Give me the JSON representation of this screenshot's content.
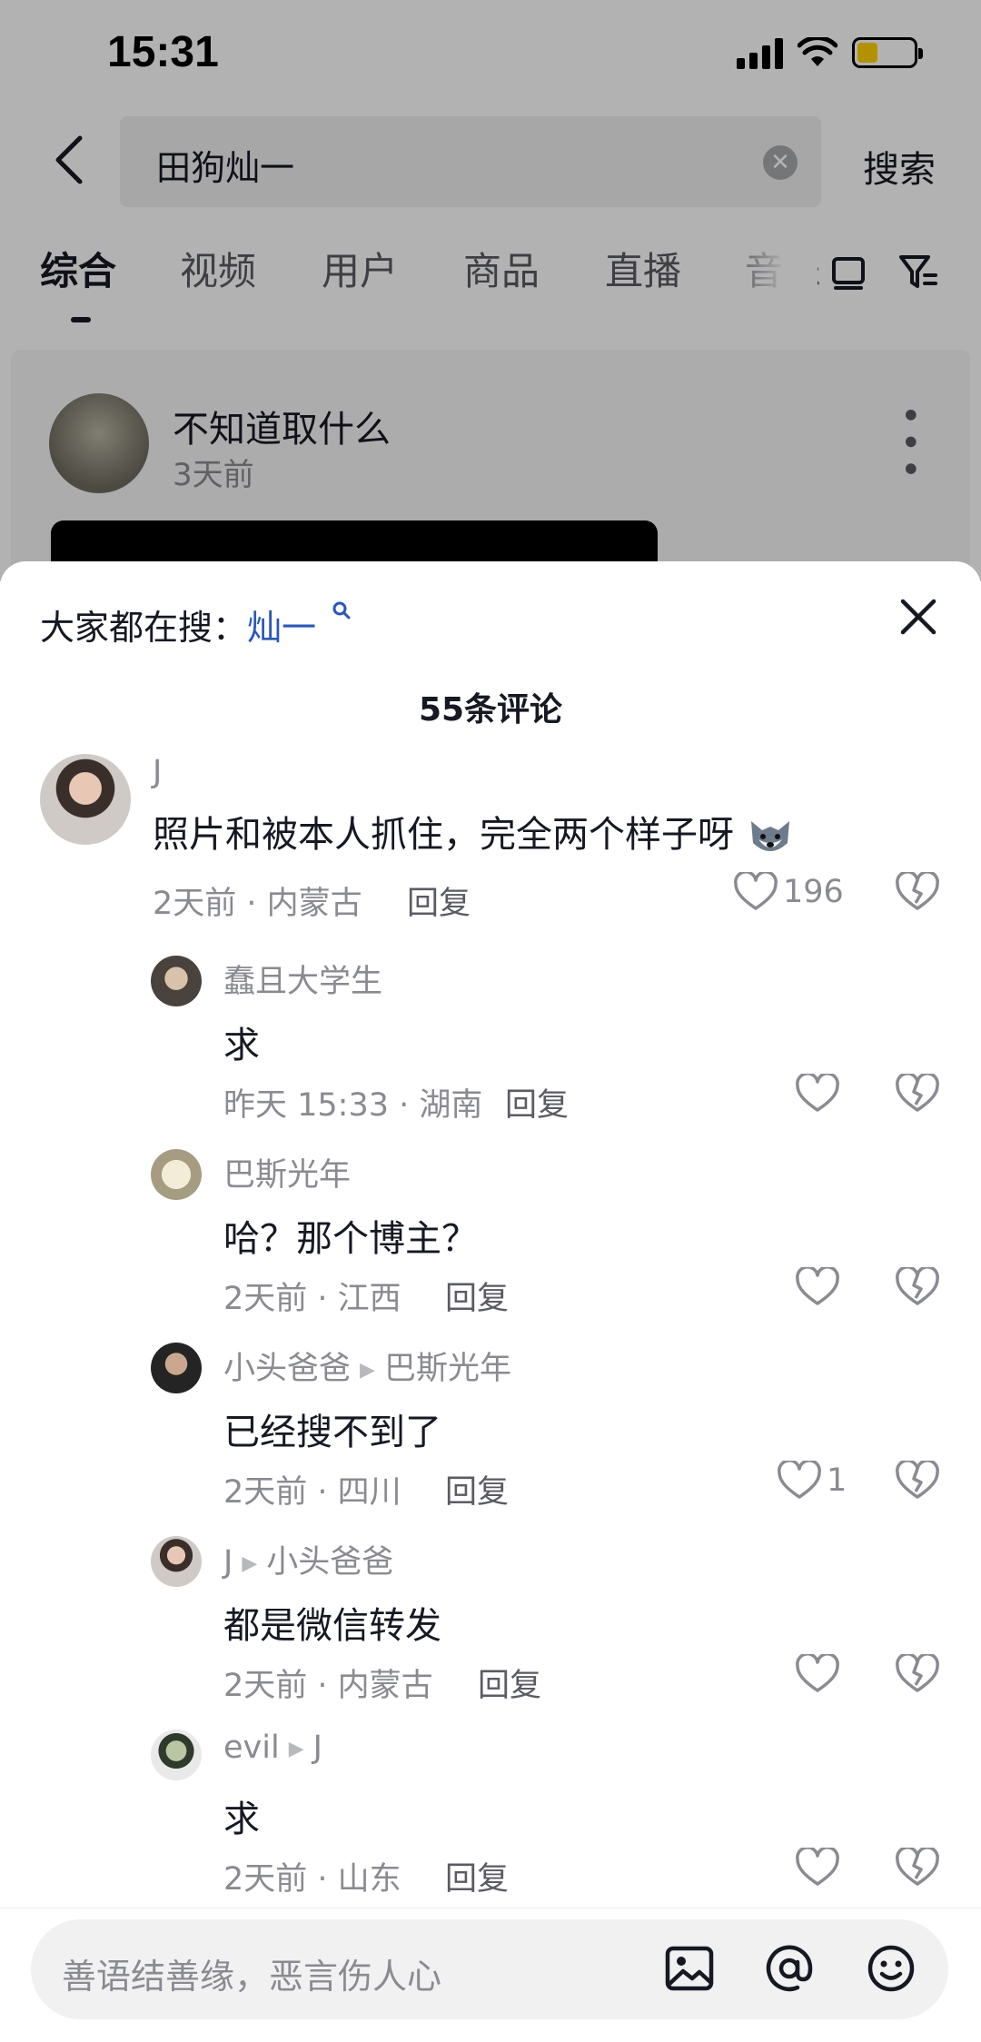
{
  "status_bar": {
    "time": "15:31"
  },
  "search": {
    "query": "田狗灿一",
    "button": "搜索"
  },
  "tabs": [
    "综合",
    "视频",
    "用户",
    "商品",
    "直播",
    "音乐"
  ],
  "result_card": {
    "author": "不知道取什么",
    "time": "3天前"
  },
  "comment_sheet": {
    "hot_prefix": "大家都在搜：",
    "hot_keyword": "灿一",
    "count_label": "55条评论",
    "reply_label": "回复",
    "comments": [
      {
        "user": "J",
        "reply_to": "",
        "text": "照片和被本人抓住，完全两个样子呀",
        "meta": "2天前 · 内蒙古",
        "likes": "196"
      },
      {
        "user": "蠢且大学生",
        "reply_to": "",
        "text": "求",
        "meta": "昨天 15:33 · 湖南",
        "likes": ""
      },
      {
        "user": "巴斯光年",
        "reply_to": "",
        "text": "哈？那个博主？",
        "meta": "2天前 · 江西",
        "likes": ""
      },
      {
        "user": "小头爸爸",
        "reply_to": "巴斯光年",
        "text": "已经搜不到了",
        "meta": "2天前 · 四川",
        "likes": "1"
      },
      {
        "user": "J",
        "reply_to": "小头爸爸",
        "text": "都是微信转发",
        "meta": "2天前 · 内蒙古",
        "likes": ""
      },
      {
        "user": "evil",
        "reply_to": "J",
        "text": "求",
        "meta": "2天前 · 山东",
        "likes": ""
      }
    ]
  },
  "input": {
    "placeholder": "善语结善缘，恶言伤人心"
  },
  "icons": {
    "back": "back-arrow-icon",
    "clear": "clear-icon",
    "layout": "layout-icon",
    "filter": "filter-icon",
    "close": "close-icon",
    "heart": "heart-icon",
    "dislike": "broken-heart-icon",
    "image": "image-icon",
    "mention": "at-icon",
    "emoji": "emoji-icon",
    "wolf": "wolf-emoji-icon"
  }
}
